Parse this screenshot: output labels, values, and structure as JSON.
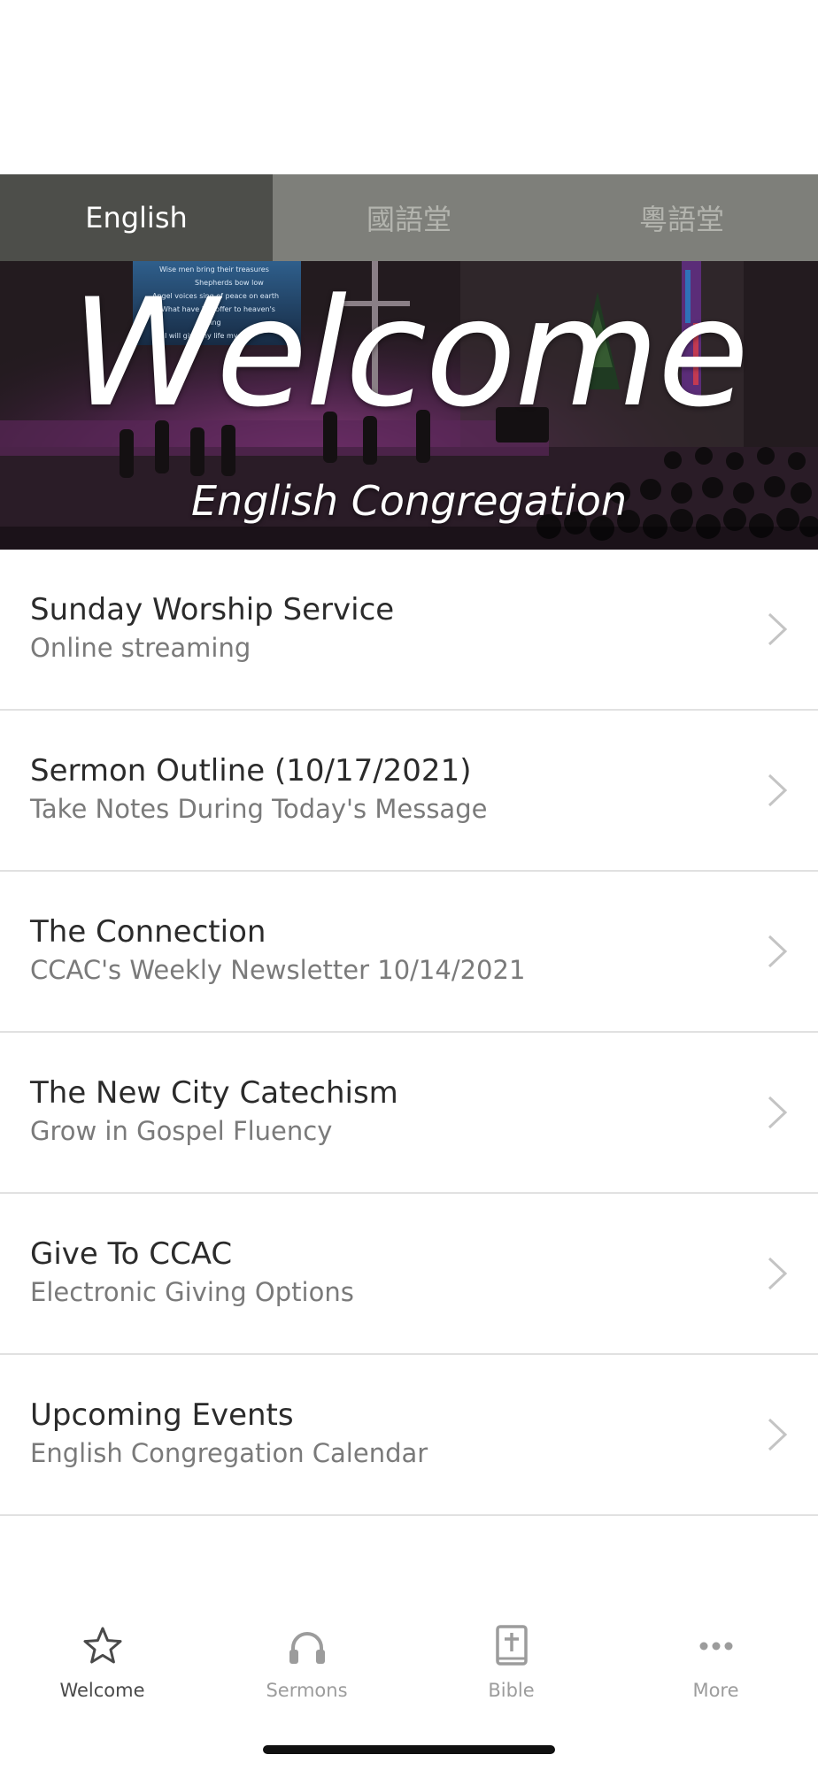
{
  "language_tabs": [
    {
      "label": "English",
      "active": true
    },
    {
      "label": "國語堂",
      "active": false
    },
    {
      "label": "粵語堂",
      "active": false
    }
  ],
  "hero": {
    "title": "Welcome",
    "subtitle": "English Congregation",
    "screen_lyrics": [
      "Wise men bring their treasures",
      "Shepherds bow low",
      "Angel voices sing of peace on earth",
      "What have I to offer to heaven's",
      "King",
      "I will give my life my all"
    ]
  },
  "menu": {
    "items": [
      {
        "title": "Sunday Worship Service",
        "subtitle": "Online streaming"
      },
      {
        "title": "Sermon Outline (10/17/2021)",
        "subtitle": "Take Notes During Today's Message"
      },
      {
        "title": "The Connection",
        "subtitle": "CCAC's Weekly Newsletter 10/14/2021"
      },
      {
        "title": "The New City Catechism",
        "subtitle": "Grow in Gospel Fluency"
      },
      {
        "title": "Give To CCAC",
        "subtitle": "Electronic Giving Options"
      },
      {
        "title": "Upcoming Events",
        "subtitle": "English Congregation Calendar"
      }
    ]
  },
  "tabbar": {
    "items": [
      {
        "label": "Welcome",
        "icon": "star-icon",
        "active": true
      },
      {
        "label": "Sermons",
        "icon": "headphones-icon",
        "active": false
      },
      {
        "label": "Bible",
        "icon": "bible-icon",
        "active": false
      },
      {
        "label": "More",
        "icon": "more-dots-icon",
        "active": false
      }
    ]
  },
  "colors": {
    "tab_active_bg": "#4d4e4a",
    "tab_inactive_bg": "#7e7f7a",
    "title_text": "#2b2b2b",
    "subtitle_text": "#7a7a7a",
    "tabbar_active": "#4a4a4a",
    "tabbar_inactive": "#9c9c9c"
  }
}
